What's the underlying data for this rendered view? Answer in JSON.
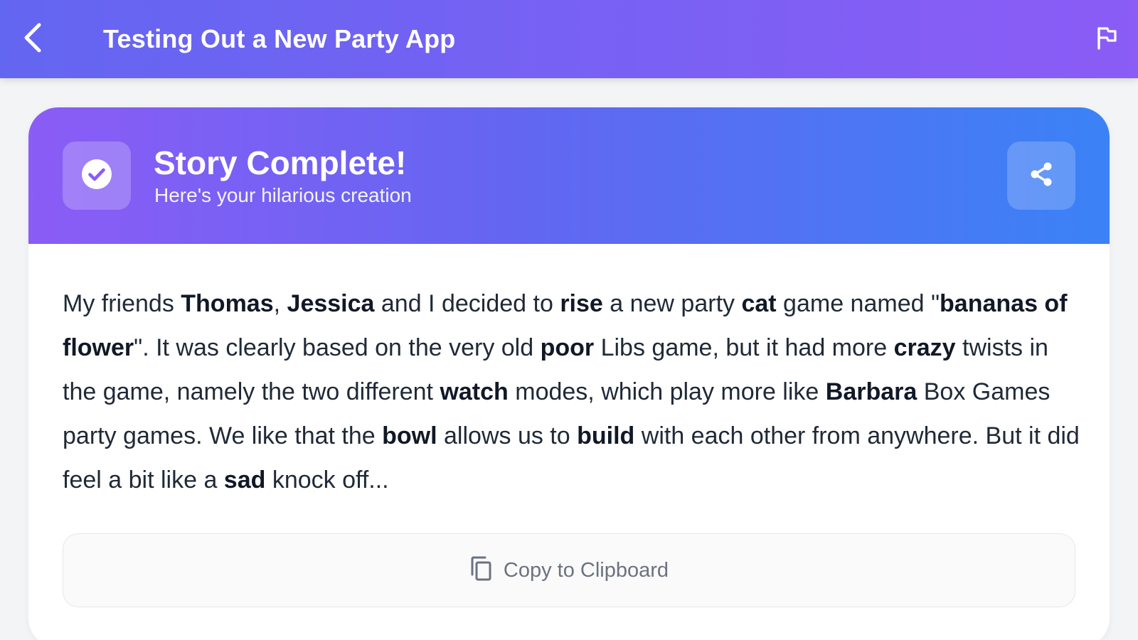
{
  "topbar": {
    "title": "Testing Out a New Party App",
    "back_icon": "chevron-left-icon",
    "flag_icon": "flag-icon"
  },
  "card": {
    "header": {
      "title": "Story Complete!",
      "subtitle": "Here's your hilarious creation",
      "status_icon": "check-circle-icon",
      "share_icon": "share-icon"
    },
    "story": {
      "segments": [
        {
          "text": "My friends ",
          "bold": false
        },
        {
          "text": "Thomas",
          "bold": true
        },
        {
          "text": ", ",
          "bold": false
        },
        {
          "text": "Jessica",
          "bold": true
        },
        {
          "text": " and I decided to ",
          "bold": false
        },
        {
          "text": "rise",
          "bold": true
        },
        {
          "text": " a new party ",
          "bold": false
        },
        {
          "text": "cat",
          "bold": true
        },
        {
          "text": " game named \"",
          "bold": false
        },
        {
          "text": "bananas of flower",
          "bold": true
        },
        {
          "text": "\". It was clearly based on the very old ",
          "bold": false
        },
        {
          "text": "poor",
          "bold": true
        },
        {
          "text": " Libs game, but it had more ",
          "bold": false
        },
        {
          "text": "crazy",
          "bold": true
        },
        {
          "text": " twists in the game, namely the two different ",
          "bold": false
        },
        {
          "text": "watch",
          "bold": true
        },
        {
          "text": " modes, which play more like ",
          "bold": false
        },
        {
          "text": "Barbara",
          "bold": true
        },
        {
          "text": " Box Games party games. We like that the ",
          "bold": false
        },
        {
          "text": "bowl",
          "bold": true
        },
        {
          "text": " allows us to ",
          "bold": false
        },
        {
          "text": "build",
          "bold": true
        },
        {
          "text": " with each other from anywhere. But it did feel a bit like a ",
          "bold": false
        },
        {
          "text": "sad",
          "bold": true
        },
        {
          "text": " knock off...",
          "bold": false
        }
      ]
    },
    "copy_button": {
      "label": "Copy to Clipboard",
      "icon": "copy-icon"
    }
  },
  "colors": {
    "topbar_start": "#6366f1",
    "topbar_end": "#8b5cf6",
    "header_start": "#8b5cf6",
    "header_end": "#3b82f6",
    "background": "#f3f4f6"
  }
}
